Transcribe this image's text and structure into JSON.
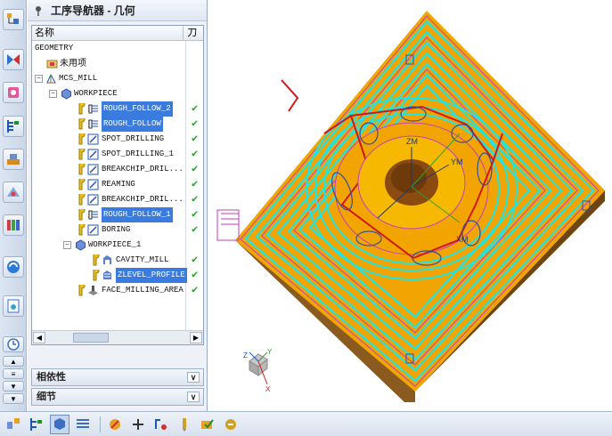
{
  "navigator": {
    "title": "工序导航器 - 几何",
    "col_name": "名称",
    "col_tool": "刀",
    "rows": [
      {
        "label": "GEOMETRY"
      },
      {
        "label": "未用项"
      },
      {
        "label": "MCS_MILL"
      },
      {
        "label": "WORKPIECE"
      },
      {
        "label": "ROUGH_FOLLOW_2"
      },
      {
        "label": "ROUGH_FOLLOW"
      },
      {
        "label": "SPOT_DRILLING"
      },
      {
        "label": "SPOT_DRILLING_1"
      },
      {
        "label": "BREAKCHIP_DRIL..."
      },
      {
        "label": "REAMING"
      },
      {
        "label": "BREAKCHIP_DRIL..."
      },
      {
        "label": "ROUGH_FOLLOW_1"
      },
      {
        "label": "BORING"
      },
      {
        "label": "WORKPIECE_1"
      },
      {
        "label": "CAVITY_MILL"
      },
      {
        "label": "ZLEVEL_PROFILE"
      },
      {
        "label": "FACE_MILLING_AREA"
      }
    ],
    "panels": {
      "dependency": "相依性",
      "details": "细节"
    }
  },
  "viewport": {
    "axis_zm": "ZM",
    "axis_ym": "YM",
    "axis_xm": "XM",
    "triad_y": "Y",
    "triad_z": "Z",
    "triad_x": "X"
  },
  "colors": {
    "selection": "#3a7be0",
    "toolpath_cyan": "#1fe4e4",
    "stock_orange": "#f2a500",
    "wall_brown": "#8a5a1e",
    "cut_red": "#d01818"
  }
}
